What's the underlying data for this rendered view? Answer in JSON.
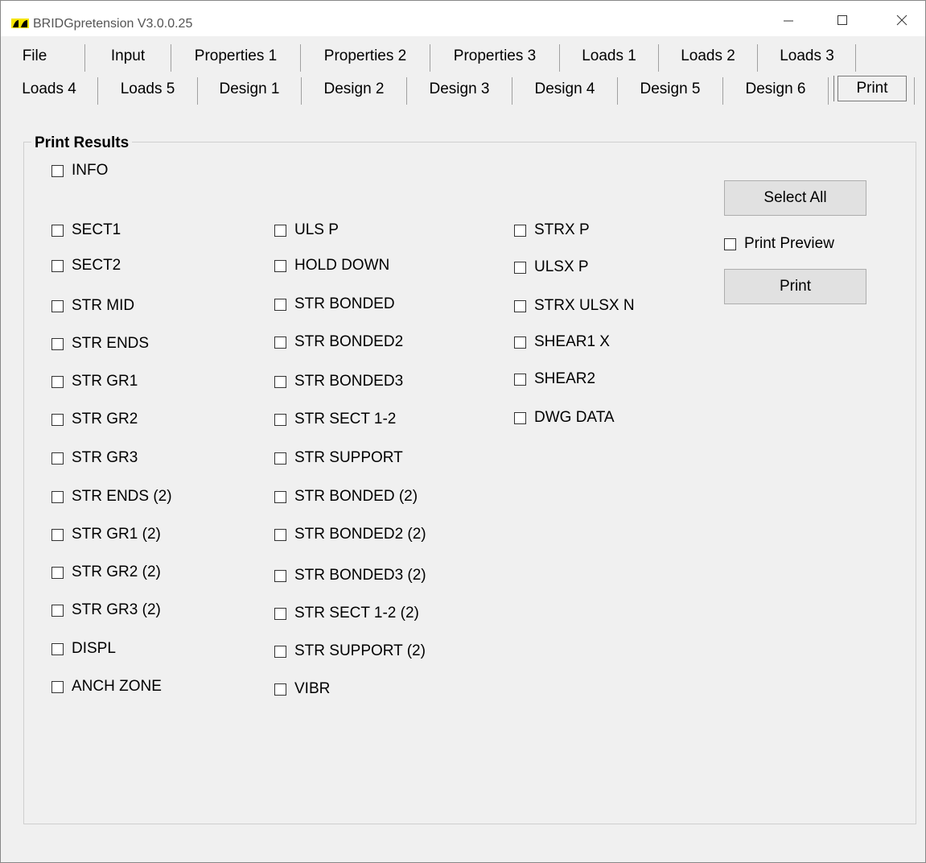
{
  "window": {
    "title": "BRIDGpretension V3.0.0.25"
  },
  "tabs_row1": [
    "File",
    "Input",
    "Properties 1",
    "Properties 2",
    "Properties 3",
    "Loads 1",
    "Loads 2",
    "Loads 3"
  ],
  "tabs_row2": [
    "Loads 4",
    "Loads 5",
    "Design 1",
    "Design 2",
    "Design 3",
    "Design 4",
    "Design 5",
    "Design 6",
    "Print"
  ],
  "active_tab": "Print",
  "print_results": {
    "group_title": "Print Results",
    "info_label": "INFO",
    "col1": [
      "SECT1",
      "SECT2",
      "STR MID",
      "STR ENDS",
      "STR GR1",
      "STR GR2",
      "STR GR3",
      "STR ENDS (2)",
      "STR GR1 (2)",
      "STR GR2 (2)",
      "STR GR3 (2)",
      "DISPL",
      "ANCH ZONE"
    ],
    "col2": [
      "ULS P",
      "HOLD DOWN",
      "STR BONDED",
      "STR BONDED2",
      "STR BONDED3",
      "STR SECT 1-2",
      "STR SUPPORT",
      "STR BONDED (2)",
      "STR BONDED2 (2)",
      "STR BONDED3 (2)",
      "STR SECT 1-2 (2)",
      "STR SUPPORT (2)",
      "VIBR"
    ],
    "col3": [
      "STRX P",
      "ULSX P",
      "STRX ULSX N",
      "SHEAR1 X",
      "SHEAR2",
      "DWG DATA"
    ]
  },
  "actions": {
    "select_all_label": "Select All",
    "print_preview_label": "Print Preview",
    "print_label": "Print"
  }
}
